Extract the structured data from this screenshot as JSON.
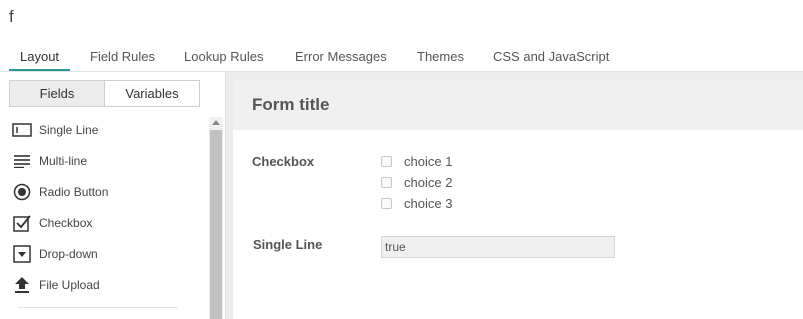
{
  "app": {
    "form_name": "f"
  },
  "tabs": [
    {
      "label": "Layout",
      "active": true
    },
    {
      "label": "Field Rules"
    },
    {
      "label": "Lookup Rules"
    },
    {
      "label": "Error Messages"
    },
    {
      "label": "Themes"
    },
    {
      "label": "CSS and JavaScript"
    }
  ],
  "left_panel": {
    "segments": [
      {
        "label": "Fields",
        "active": true
      },
      {
        "label": "Variables"
      }
    ],
    "fields": [
      {
        "label": "Single Line",
        "icon": "single-line-icon"
      },
      {
        "label": "Multi-line",
        "icon": "multi-line-icon"
      },
      {
        "label": "Radio Button",
        "icon": "radio-button-icon"
      },
      {
        "label": "Checkbox",
        "icon": "checkbox-icon"
      },
      {
        "label": "Drop-down",
        "icon": "dropdown-icon"
      },
      {
        "label": "File Upload",
        "icon": "upload-icon"
      }
    ]
  },
  "form": {
    "title": "Form title",
    "checkbox_field": {
      "label": "Checkbox",
      "choices": [
        "choice 1",
        "choice 2",
        "choice 3"
      ]
    },
    "single_line_field": {
      "label": "Single Line",
      "value": "true"
    }
  },
  "colors": {
    "accent": "#2b9a8f",
    "header_bg": "#f0f0f0",
    "canvas_bg": "#ececec"
  }
}
